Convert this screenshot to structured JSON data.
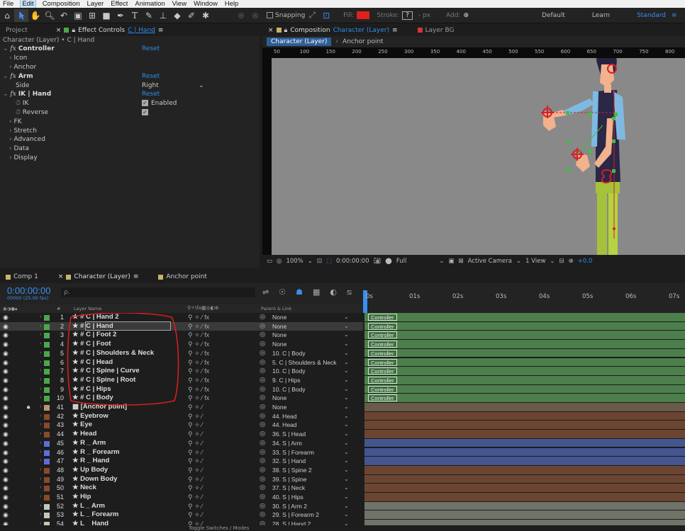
{
  "menu": [
    "File",
    "Edit",
    "Composition",
    "Layer",
    "Effect",
    "Animation",
    "View",
    "Window",
    "Help"
  ],
  "toolbar": {
    "snapping": "Snapping",
    "fill": "Fill:",
    "stroke": "Stroke:",
    "stroke_value": "?",
    "stroke_unit": "- px",
    "add": "Add:",
    "workspaces": [
      "Default",
      "Learn",
      "Standard"
    ],
    "fill_color": "#e0201c"
  },
  "left_panel": {
    "tab_project": "Project",
    "tab_effects": "Effect Controls",
    "tab_effects_target": "C | Hand",
    "breadcrumb": "Character (Layer) • C | Hand",
    "rows": [
      {
        "label": "Controller",
        "fx": true,
        "indent": 0,
        "value": "Reset",
        "value_style": "link"
      },
      {
        "label": "Icon",
        "indent": 1,
        "value": ""
      },
      {
        "label": "Anchor",
        "indent": 1,
        "value": ""
      },
      {
        "label": "Arm",
        "fx": true,
        "indent": 0,
        "value": "Reset",
        "value_style": "link"
      },
      {
        "label": "Side",
        "indent": 2,
        "value": "Right",
        "value_style": "dropdown"
      },
      {
        "label": "IK | Hand",
        "fx": true,
        "indent": 0,
        "value": "Reset",
        "value_style": "link"
      },
      {
        "label": "IK",
        "indent": 2,
        "stopwatch": true,
        "value": "Enabled",
        "value_style": "check"
      },
      {
        "label": "Reverse",
        "indent": 2,
        "stopwatch": true,
        "value": "",
        "value_style": "check"
      },
      {
        "label": "FK",
        "indent": 1,
        "value": ""
      },
      {
        "label": "Stretch",
        "indent": 1,
        "value": ""
      },
      {
        "label": "Advanced",
        "indent": 1,
        "value": ""
      },
      {
        "label": "Data",
        "indent": 1,
        "value": ""
      },
      {
        "label": "Display",
        "indent": 1,
        "value": ""
      }
    ]
  },
  "comp_panel": {
    "tab_label": "Composition",
    "tab_target": "Character (Layer)",
    "tab2": "Layer BG",
    "crumb1": "Character (Layer)",
    "crumb2": "Anchor point",
    "ruler": [
      "50",
      "100",
      "150",
      "200",
      "250",
      "300",
      "350",
      "400",
      "450",
      "500",
      "550",
      "600",
      "650",
      "700",
      "750",
      "800"
    ],
    "zoom": "100%",
    "timecode": "0:00:00:00",
    "resolution": "Full",
    "camera": "Active Camera",
    "view": "1 View",
    "exposure": "+0.0"
  },
  "timeline": {
    "tabs": [
      "Comp 1",
      "Character (Layer)",
      "Anchor point"
    ],
    "timecode": "0:00:00:00",
    "fps": "00000 (25.00 fps)",
    "search_placeholder": "ρ.",
    "col_layer_name": "Layer Name",
    "col_hash": "#",
    "col_parent": "Parent & Link",
    "ruler": [
      "0s",
      "01s",
      "02s",
      "03s",
      "04s",
      "05s",
      "06s",
      "07s"
    ],
    "bottom_label": "Toggle Switches / Modes",
    "layers": [
      {
        "num": "1",
        "name": "C | Hand 2",
        "color": "#4aa84a",
        "ctrl": true,
        "parent": "None",
        "selected": false
      },
      {
        "num": "2",
        "name": "C | Hand",
        "color": "#4aa84a",
        "ctrl": true,
        "parent": "None",
        "selected": true
      },
      {
        "num": "3",
        "name": "C | Foot 2",
        "color": "#4aa84a",
        "ctrl": true,
        "parent": "None",
        "selected": false
      },
      {
        "num": "4",
        "name": "C | Foot",
        "color": "#4aa84a",
        "ctrl": true,
        "parent": "None",
        "selected": false
      },
      {
        "num": "5",
        "name": "C | Shoulders & Neck",
        "color": "#4aa84a",
        "ctrl": true,
        "parent": "10. C | Body",
        "selected": false
      },
      {
        "num": "6",
        "name": "C | Head",
        "color": "#4aa84a",
        "ctrl": true,
        "parent": "5. C | Shoulders & Neck",
        "selected": false
      },
      {
        "num": "7",
        "name": "C | Spine | Curve",
        "color": "#4aa84a",
        "ctrl": true,
        "parent": "10. C | Body",
        "selected": false
      },
      {
        "num": "8",
        "name": "C | Spine | Root",
        "color": "#4aa84a",
        "ctrl": true,
        "parent": "9. C | Hips",
        "selected": false
      },
      {
        "num": "9",
        "name": "C | Hips",
        "color": "#4aa84a",
        "ctrl": true,
        "parent": "10. C | Body",
        "selected": false
      },
      {
        "num": "10",
        "name": "C | Body",
        "color": "#4aa84a",
        "ctrl": true,
        "parent": "None",
        "selected": false
      },
      {
        "num": "41",
        "name": "[Anchor point]",
        "color": "#b89770",
        "ctrl": false,
        "parent": "None",
        "locked": true,
        "track": "#6a5a4a"
      },
      {
        "num": "42",
        "name": "Eyebrow",
        "color": "#8a4a2a",
        "ctrl": false,
        "parent": "44. Head",
        "track": "#6b4532"
      },
      {
        "num": "43",
        "name": "Eye",
        "color": "#8a4a2a",
        "ctrl": false,
        "parent": "44. Head",
        "track": "#6b4532"
      },
      {
        "num": "44",
        "name": "Head",
        "color": "#8a4a2a",
        "ctrl": false,
        "parent": "36. S | Head",
        "track": "#6b4532"
      },
      {
        "num": "45",
        "name": "R _ Arm",
        "color": "#5b6fd6",
        "ctrl": false,
        "parent": "34. S | Arm",
        "track": "#44558f"
      },
      {
        "num": "46",
        "name": "R _ Forearm",
        "color": "#5b6fd6",
        "ctrl": false,
        "parent": "33. S | Forearm",
        "track": "#44558f"
      },
      {
        "num": "47",
        "name": "R _ Hand",
        "color": "#5b6fd6",
        "ctrl": false,
        "parent": "32. S | Hand",
        "track": "#44558f"
      },
      {
        "num": "48",
        "name": "Up Body",
        "color": "#8a4a2a",
        "ctrl": false,
        "parent": "38. S | Spine 2",
        "track": "#6b4532"
      },
      {
        "num": "49",
        "name": "Down Body",
        "color": "#8a4a2a",
        "ctrl": false,
        "parent": "39. S | Spine",
        "track": "#6b4532"
      },
      {
        "num": "50",
        "name": "Neck",
        "color": "#8a4a2a",
        "ctrl": false,
        "parent": "37. S | Neck",
        "track": "#6b4532"
      },
      {
        "num": "51",
        "name": "Hip",
        "color": "#8a4a2a",
        "ctrl": false,
        "parent": "40. S | Hips",
        "track": "#6b4532"
      },
      {
        "num": "52",
        "name": "L _ Arm",
        "color": "#c0c8b8",
        "ctrl": false,
        "parent": "30. S | Arm 2",
        "track": "#6f7368"
      },
      {
        "num": "53",
        "name": "L _ Forearm",
        "color": "#c0c8b8",
        "ctrl": false,
        "parent": "29. S | Forearm 2",
        "track": "#6f7368"
      },
      {
        "num": "54",
        "name": "L _ Hand",
        "color": "#c0c8b8",
        "ctrl": false,
        "parent": "28. S | Hand 2",
        "track": "#6f7368"
      }
    ],
    "ctrl_label": "Controller"
  }
}
